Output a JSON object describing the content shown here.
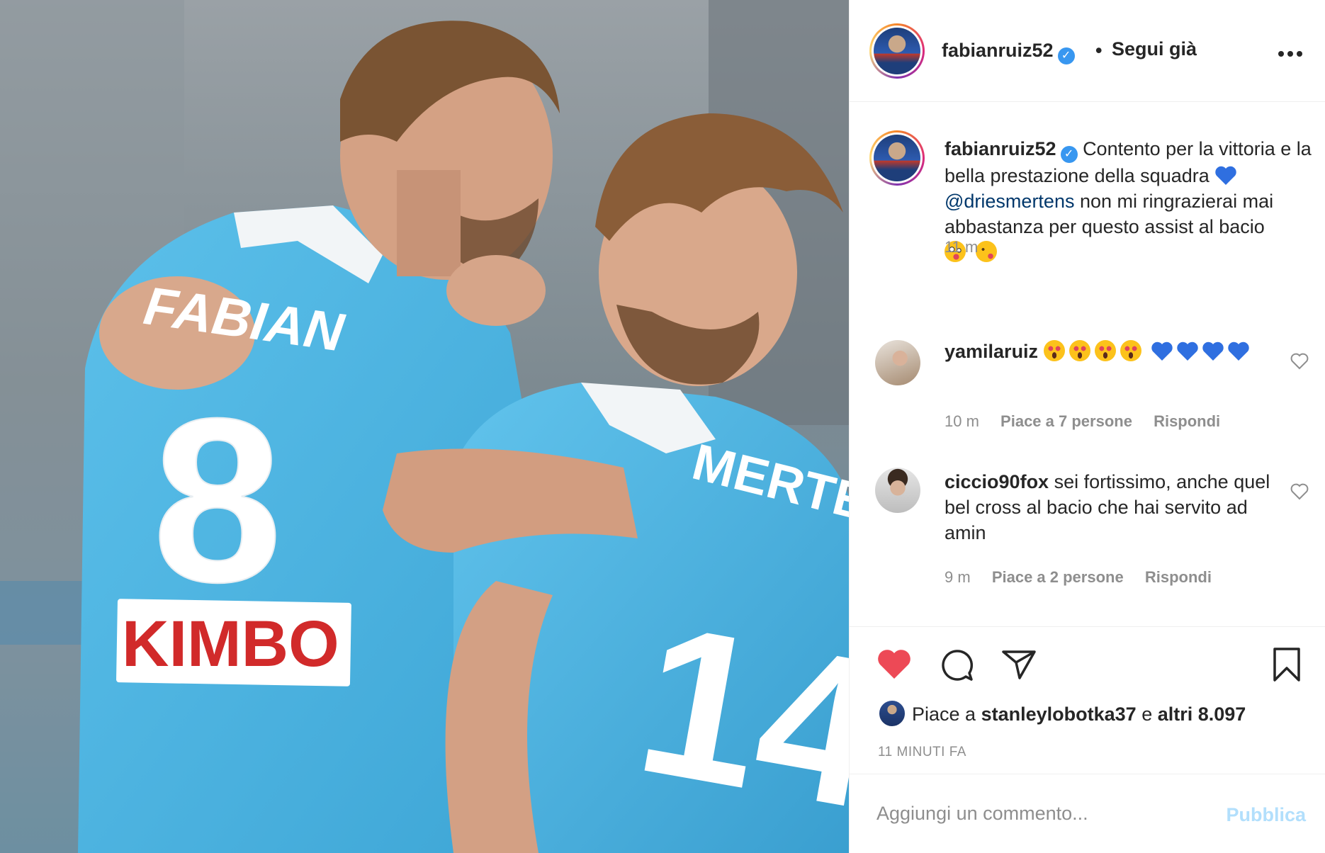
{
  "post": {
    "username": "fabianruiz52",
    "verified_mark": "✓",
    "dot": "•",
    "follow_label": "Segui già",
    "more_icon": "more-options-icon",
    "photo_text": {
      "left_name": "FABIAN",
      "left_number": "8",
      "sponsor": "KIMBO",
      "right_name": "MERTENS",
      "right_number": "14"
    }
  },
  "caption": {
    "username": "fabianruiz52",
    "text_1": "Contento per la vittoria e la bella prestazione della squadra",
    "mention": "@driesmertens",
    "text_2": "non mi ringrazierai mai abbastanza per questo assist al bacio",
    "time": "11 m"
  },
  "comments": [
    {
      "username": "yamilaruiz",
      "text": "",
      "time": "10 m",
      "likes": "Piace a 7 persone",
      "reply": "Rispondi"
    },
    {
      "username": "ciccio90fox",
      "text": "sei fortissimo, anche quel bel cross al bacio che hai servito ad amin",
      "time": "9 m",
      "likes": "Piace a 2 persone",
      "reply": "Rispondi"
    }
  ],
  "actions": {
    "likes_prefix": "Piace a",
    "likes_user": "stanleylobotka37",
    "likes_joiner": "e",
    "likes_rest": "altri 8.097",
    "posted_ago": "11 MINUTI FA"
  },
  "add_comment": {
    "placeholder": "Aggiungi un commento...",
    "publish_label": "Pubblica"
  },
  "colors": {
    "like_red": "#ed4956",
    "link_blue": "#00376b",
    "verified_blue": "#3897f0",
    "publish_disabled": "#b2dffc",
    "jersey_blue": "#4fb3e0"
  }
}
